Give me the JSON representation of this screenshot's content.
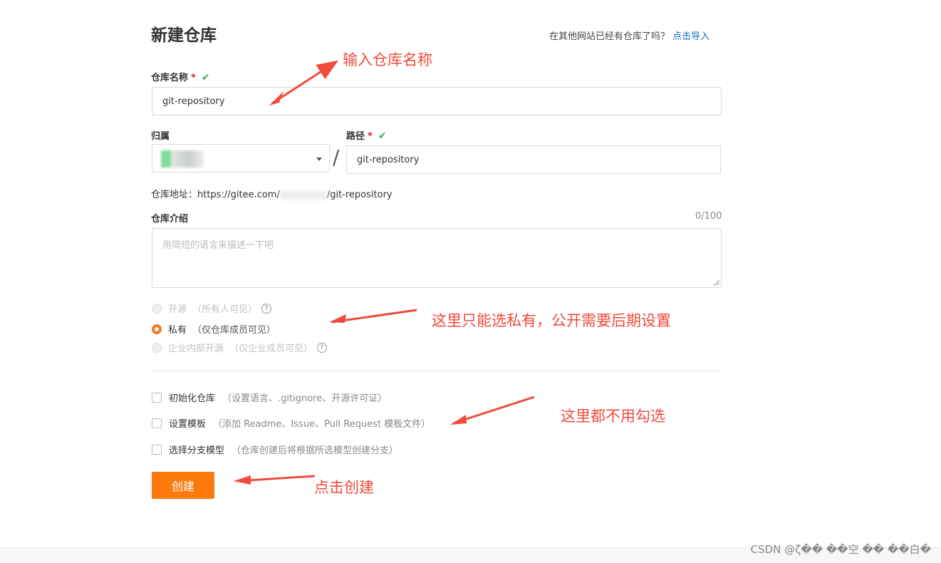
{
  "header": {
    "title": "新建仓库",
    "import_hint": "在其他网站已经有仓库了吗？",
    "import_link": "点击导入"
  },
  "repo_name": {
    "label": "仓库名称",
    "required_mark": "*",
    "check": "✔",
    "value": "git-repository"
  },
  "owner": {
    "label": "归属"
  },
  "path": {
    "label": "路径",
    "required_mark": "*",
    "check": "✔",
    "value": "git-repository",
    "separator": "/"
  },
  "repo_url": {
    "prefix": "仓库地址：https://gitee.com/",
    "suffix": "/git-repository"
  },
  "intro": {
    "label": "仓库介绍",
    "counter": "0/100",
    "placeholder": "用简短的语言来描述一下吧"
  },
  "visibility": {
    "options": [
      {
        "label": "开源",
        "desc": "（所有人可见）",
        "disabled": true,
        "help": "?"
      },
      {
        "label": "私有",
        "desc": "（仅仓库成员可见）",
        "selected": true
      },
      {
        "label": "企业内部开源",
        "desc": "（仅企业成员可见）",
        "disabled": true,
        "help": "?"
      }
    ]
  },
  "options": [
    {
      "label": "初始化仓库",
      "desc": "（设置语言、.gitignore、开源许可证）"
    },
    {
      "label": "设置模板",
      "desc": "（添加 Readme、Issue、Pull Request 模板文件）"
    },
    {
      "label": "选择分支模型",
      "desc": "（仓库创建后将根据所选模型创建分支）"
    }
  ],
  "submit": {
    "label": "创建"
  },
  "annotations": {
    "a1": "输入仓库名称",
    "a2": "这里只能选私有，公开需要后期设置",
    "a3": "这里都不用勾选",
    "a4": "点击创建",
    "color": "#f04a3a"
  },
  "watermark": "CSDN @ζ�� ��空 ��  ��白�",
  "colors": {
    "accent": "#fc7a0c",
    "link": "#1e6fbf",
    "success": "#3aa853"
  }
}
